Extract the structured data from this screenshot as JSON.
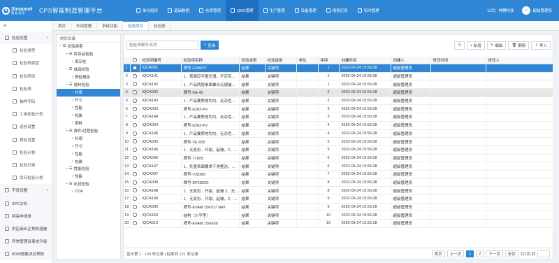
{
  "brand": {
    "logo_name": "Sinopont",
    "logo_sub": "赛 能 科 技",
    "app_title": "CPS智能制造管理平台"
  },
  "nav": [
    {
      "label": "单位组织",
      "active": false
    },
    {
      "label": "基础数据",
      "active": false
    },
    {
      "label": "仓库管理",
      "active": false
    },
    {
      "label": "QMS管理",
      "active": true
    },
    {
      "label": "生产管理",
      "active": false
    },
    {
      "label": "设备管理",
      "active": false
    },
    {
      "label": "报表应用",
      "active": false
    },
    {
      "label": "实时管理",
      "active": false
    }
  ],
  "topright": {
    "company": "公司：祥腾科技",
    "user": "超级管理员"
  },
  "tabs": [
    {
      "label": "首页",
      "active": false
    },
    {
      "label": "车间管理",
      "active": false
    },
    {
      "label": "系统功能",
      "active": false
    },
    {
      "label": "检验项目",
      "active": true
    },
    {
      "label": "检验表",
      "active": false
    }
  ],
  "sidebar": [
    {
      "label": "检验设置",
      "type": "group",
      "caret": "∧"
    },
    {
      "label": "检验类型",
      "type": "sub"
    },
    {
      "label": "检验项类型",
      "type": "sub"
    },
    {
      "label": "检验项目",
      "type": "sub"
    },
    {
      "label": "检验表",
      "type": "sub"
    },
    {
      "label": "抽样字码",
      "type": "sub"
    },
    {
      "label": "工单检验计划",
      "type": "sub"
    },
    {
      "label": "巡检设置",
      "type": "sub"
    },
    {
      "label": "首检设置",
      "type": "sub"
    },
    {
      "label": "检验计划",
      "type": "sub"
    },
    {
      "label": "检验记录",
      "type": "sub"
    },
    {
      "label": "库存检验计划",
      "type": "sub"
    },
    {
      "label": "不良设置",
      "type": "group",
      "caret": "∨"
    },
    {
      "label": "SPC分析",
      "type": "group",
      "caret": ""
    },
    {
      "label": "特采申请单",
      "type": "group",
      "caret": ""
    },
    {
      "label": "供应商纠正预防措施",
      "type": "group",
      "caret": ""
    },
    {
      "label": "异常管理及事态升级",
      "type": "group",
      "caret": ""
    },
    {
      "label": "8D问题解决及预防",
      "type": "group",
      "caret": ""
    }
  ],
  "tree": {
    "header": "树形目录",
    "nodes": [
      {
        "label": "检验类型",
        "level": 0,
        "prefix": "− ☰"
      },
      {
        "label": "库存品检验",
        "level": 1,
        "prefix": "− ☰"
      },
      {
        "label": "库存检",
        "level": 2,
        "prefix": "›"
      },
      {
        "label": "成品检验",
        "level": 1,
        "prefix": "− ☰"
      },
      {
        "label": "质检报告",
        "level": 2,
        "prefix": "›"
      },
      {
        "label": "进料检验",
        "level": 1,
        "prefix": "− ☰"
      },
      {
        "label": "外观",
        "level": 2,
        "prefix": "›",
        "sel": true
      },
      {
        "label": "尺寸",
        "level": 2,
        "prefix": "›"
      },
      {
        "label": "性能",
        "level": 2,
        "prefix": "›"
      },
      {
        "label": "包装",
        "level": 2,
        "prefix": "›"
      },
      {
        "label": "资料",
        "level": 2,
        "prefix": "›"
      },
      {
        "label": "首件/过程检验",
        "level": 1,
        "prefix": "− ☰"
      },
      {
        "label": "外观",
        "level": 2,
        "prefix": "›"
      },
      {
        "label": "尺寸",
        "level": 2,
        "prefix": "›"
      },
      {
        "label": "性能",
        "level": 2,
        "prefix": "›"
      },
      {
        "label": "包装",
        "level": 2,
        "prefix": "›"
      },
      {
        "label": "性能检验",
        "level": 1,
        "prefix": "− ☰"
      },
      {
        "label": "性能",
        "level": 2,
        "prefix": "›"
      },
      {
        "label": "出货检验",
        "level": 1,
        "prefix": "− ☰"
      },
      {
        "label": "COA",
        "level": 2,
        "prefix": "›"
      }
    ]
  },
  "search": {
    "placeholder": "检验项编号/名称",
    "button": "查询"
  },
  "toolbar": {
    "refresh": "⟳",
    "add": "+ 新增",
    "edit": "编辑",
    "delete": "删除",
    "import": "导入"
  },
  "table": {
    "columns": [
      "",
      "",
      "检验项编号",
      "检验项名称",
      "检验类型",
      "检验级别",
      "单位",
      "排序",
      "创建时间",
      "创建人",
      "修改时间",
      "修改人"
    ],
    "rows": [
      [
        "1",
        "IQCA001",
        "牌号-E280PV",
        "结果",
        "关键项",
        "",
        "1",
        "2022-06-24 15:56:28",
        "超级管理员"
      ],
      [
        "2",
        "IQCA141",
        "1、表面应平整光滑，不应有明...",
        "结果",
        "关键项",
        "",
        "1",
        "2022-06-24 15:56:28",
        "超级管理员"
      ],
      [
        "3",
        "IQCA142",
        "1、产品两层单面聚合无褶皱...",
        "结果",
        "关键项",
        "",
        "1",
        "2022-06-24 15:56:28",
        "超级管理员"
      ],
      [
        "4",
        "IQCA002",
        "牌号-KA-40",
        "结果",
        "关键项",
        "",
        "2",
        "2022-06-24 15:56:28",
        "超级管理员"
      ],
      [
        "5",
        "IQCA143",
        "1、产品要质地均匀，无杂色、...",
        "结果",
        "关键项",
        "",
        "2",
        "2022-06-24 15:56:28",
        "超级管理员"
      ],
      [
        "6",
        "IQCA003",
        "牌号-E282-PV",
        "结果",
        "关键项",
        "",
        "3",
        "2022-06-24 15:56:28",
        "超级管理员"
      ],
      [
        "7",
        "IQCA144",
        "1、产品要质地均匀，无杂色、...",
        "结果",
        "关键项",
        "",
        "3",
        "2022-06-24 15:56:28",
        "超级管理员"
      ],
      [
        "8",
        "IQCA004",
        "牌号-E262-PV",
        "结果",
        "关键项",
        "",
        "4",
        "2022-06-24 15:56:28",
        "超级管理员"
      ],
      [
        "9",
        "IQCA145",
        "1、产品要质地均匀，无杂色、...",
        "结果",
        "关键项",
        "",
        "4",
        "2022-06-24 15:56:28",
        "超级管理员"
      ],
      [
        "10",
        "IQCA005",
        "牌号-VE 830",
        "结果",
        "关键项",
        "",
        "5",
        "2022-06-24 15:56:28",
        "超级管理员"
      ],
      [
        "11",
        "IQCA146",
        "1、无变形、开裂、起皱，2、...",
        "结果",
        "关键项",
        "",
        "5",
        "2022-06-24 15:56:28",
        "超级管理员"
      ],
      [
        "12",
        "IQCA006",
        "牌号-7760S",
        "结果",
        "关键项",
        "",
        "6",
        "2022-06-24 15:56:28",
        "超级管理员"
      ],
      [
        "13",
        "IQCA147",
        "1、托盘表面要求干净整洁，干...",
        "结果",
        "关键项",
        "",
        "6",
        "2022-06-24 15:56:28",
        "超级管理员"
      ],
      [
        "14",
        "IQCA007",
        "牌号-V28280",
        "结果",
        "关键项",
        "",
        "7",
        "2022-06-24 15:56:28",
        "超级管理员"
      ],
      [
        "15",
        "IQCA008",
        "牌号-EP2802S",
        "结果",
        "关键项",
        "",
        "8",
        "2022-06-24 15:56:28",
        "超级管理员"
      ],
      [
        "16",
        "IQCA148",
        "1、无变形、开裂、起皱 2、无...",
        "结果",
        "关键项",
        "",
        "8",
        "2022-06-24 15:56:28",
        "超级管理员"
      ],
      [
        "17",
        "IQCA149",
        "1、无变形、开裂、起皱，2、...",
        "结果",
        "关键项",
        "",
        "9",
        "2022-06-24 15:56:28",
        "超级管理员"
      ],
      [
        "18",
        "IQCA009",
        "牌号-EVAM 15F917 NAT",
        "结果",
        "关键项",
        "",
        "9",
        "2022-06-24 15:56:28",
        "超级管理员"
      ],
      [
        "19",
        "IQCA150",
        "结构（川字型）",
        "结果",
        "关键项",
        "",
        "10",
        "2022-06-24 15:56:28",
        "超级管理员"
      ],
      [
        "20",
        "IQCA010",
        "牌号-EVAM 15G038",
        "结果",
        "关键项",
        "",
        "10",
        "2022-06-24 15:56:28",
        "超级管理员"
      ]
    ]
  },
  "footer": {
    "summary": "显示第 1 - 100 条记录 | 检索到 121 条记录",
    "first": "首页",
    "prev": "上一页",
    "p1": "1",
    "p2": "2",
    "next": "下一页",
    "last": "末页",
    "total": "共2页,到"
  }
}
